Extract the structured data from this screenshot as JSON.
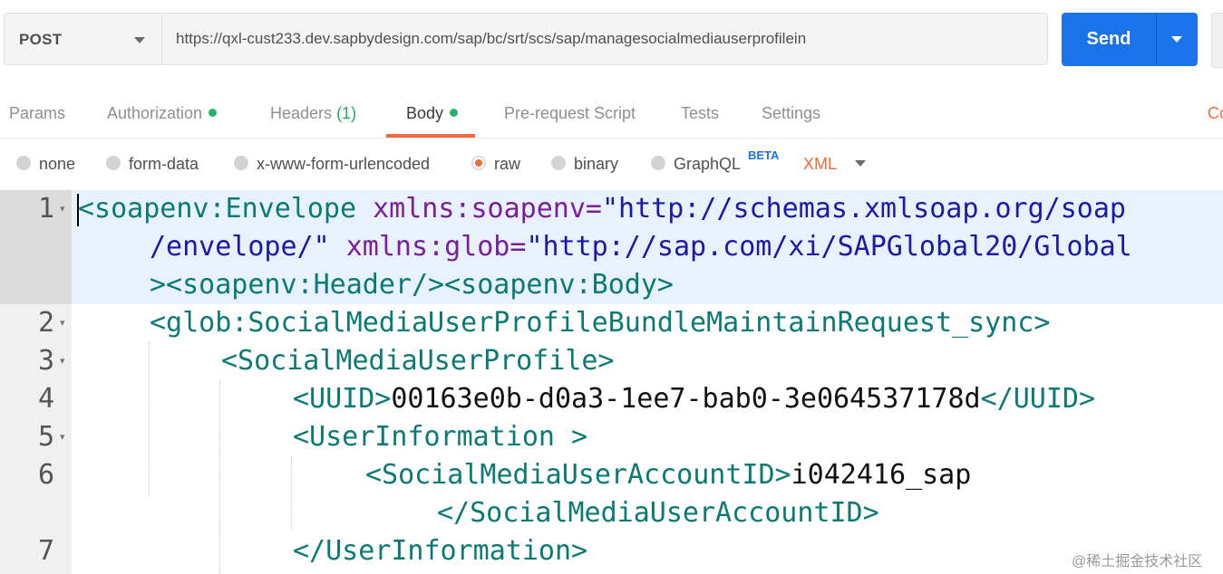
{
  "request": {
    "method": "POST",
    "url": "https://qxl-cust233.dev.sapbydesign.com/sap/bc/srt/scs/sap/managesocialmediauserprofilein",
    "send_label": "Send"
  },
  "tabs": {
    "params": "Params",
    "authorization": "Authorization",
    "headers": "Headers",
    "headers_count": "(1)",
    "body": "Body",
    "prerequest": "Pre-request Script",
    "tests": "Tests",
    "settings": "Settings",
    "cookies_partial": "Co"
  },
  "body_options": {
    "none": "none",
    "form_data": "form-data",
    "urlencoded": "x-www-form-urlencoded",
    "raw": "raw",
    "binary": "binary",
    "graphql": "GraphQL",
    "beta": "BETA",
    "language": "XML",
    "selected": "raw"
  },
  "editor": {
    "line_numbers": [
      "1",
      "2",
      "3",
      "4",
      "5",
      "6",
      "7"
    ],
    "lines": {
      "l1a_tag": "<soapenv:Envelope ",
      "l1a_attr": "xmlns:soapenv=",
      "l1a_str": "\"http://schemas.xmlsoap.org/soap",
      "l1b_str": "/envelope/\"",
      "l1b_attr": " xmlns:glob=",
      "l1b_str2": "\"http://sap.com/xi/SAPGlobal20/Global",
      "l1c_tag": "><soapenv:Header/><soapenv:Body>",
      "l2_tag": "<glob:SocialMediaUserProfileBundleMaintainRequest_sync>",
      "l3_tag": "<SocialMediaUserProfile>",
      "l4_open": "<UUID>",
      "l4_text": "00163e0b-d0a3-1ee7-bab0-3e064537178d",
      "l4_close": "</UUID>",
      "l5_tag": "<UserInformation >",
      "l6_open": "<SocialMediaUserAccountID>",
      "l6_text": "i042416_sap",
      "l6_close": "</SocialMediaUserAccountID>",
      "l7_tag": "</UserInformation>"
    }
  },
  "watermark": "@稀土掘金技术社区",
  "colors": {
    "accent": "#f26b3a",
    "send": "#1a73e8",
    "tag": "#0b7a75",
    "attribute": "#7a1e9a",
    "string": "#1a1aa6",
    "indicator_dot": "#26b36b"
  }
}
